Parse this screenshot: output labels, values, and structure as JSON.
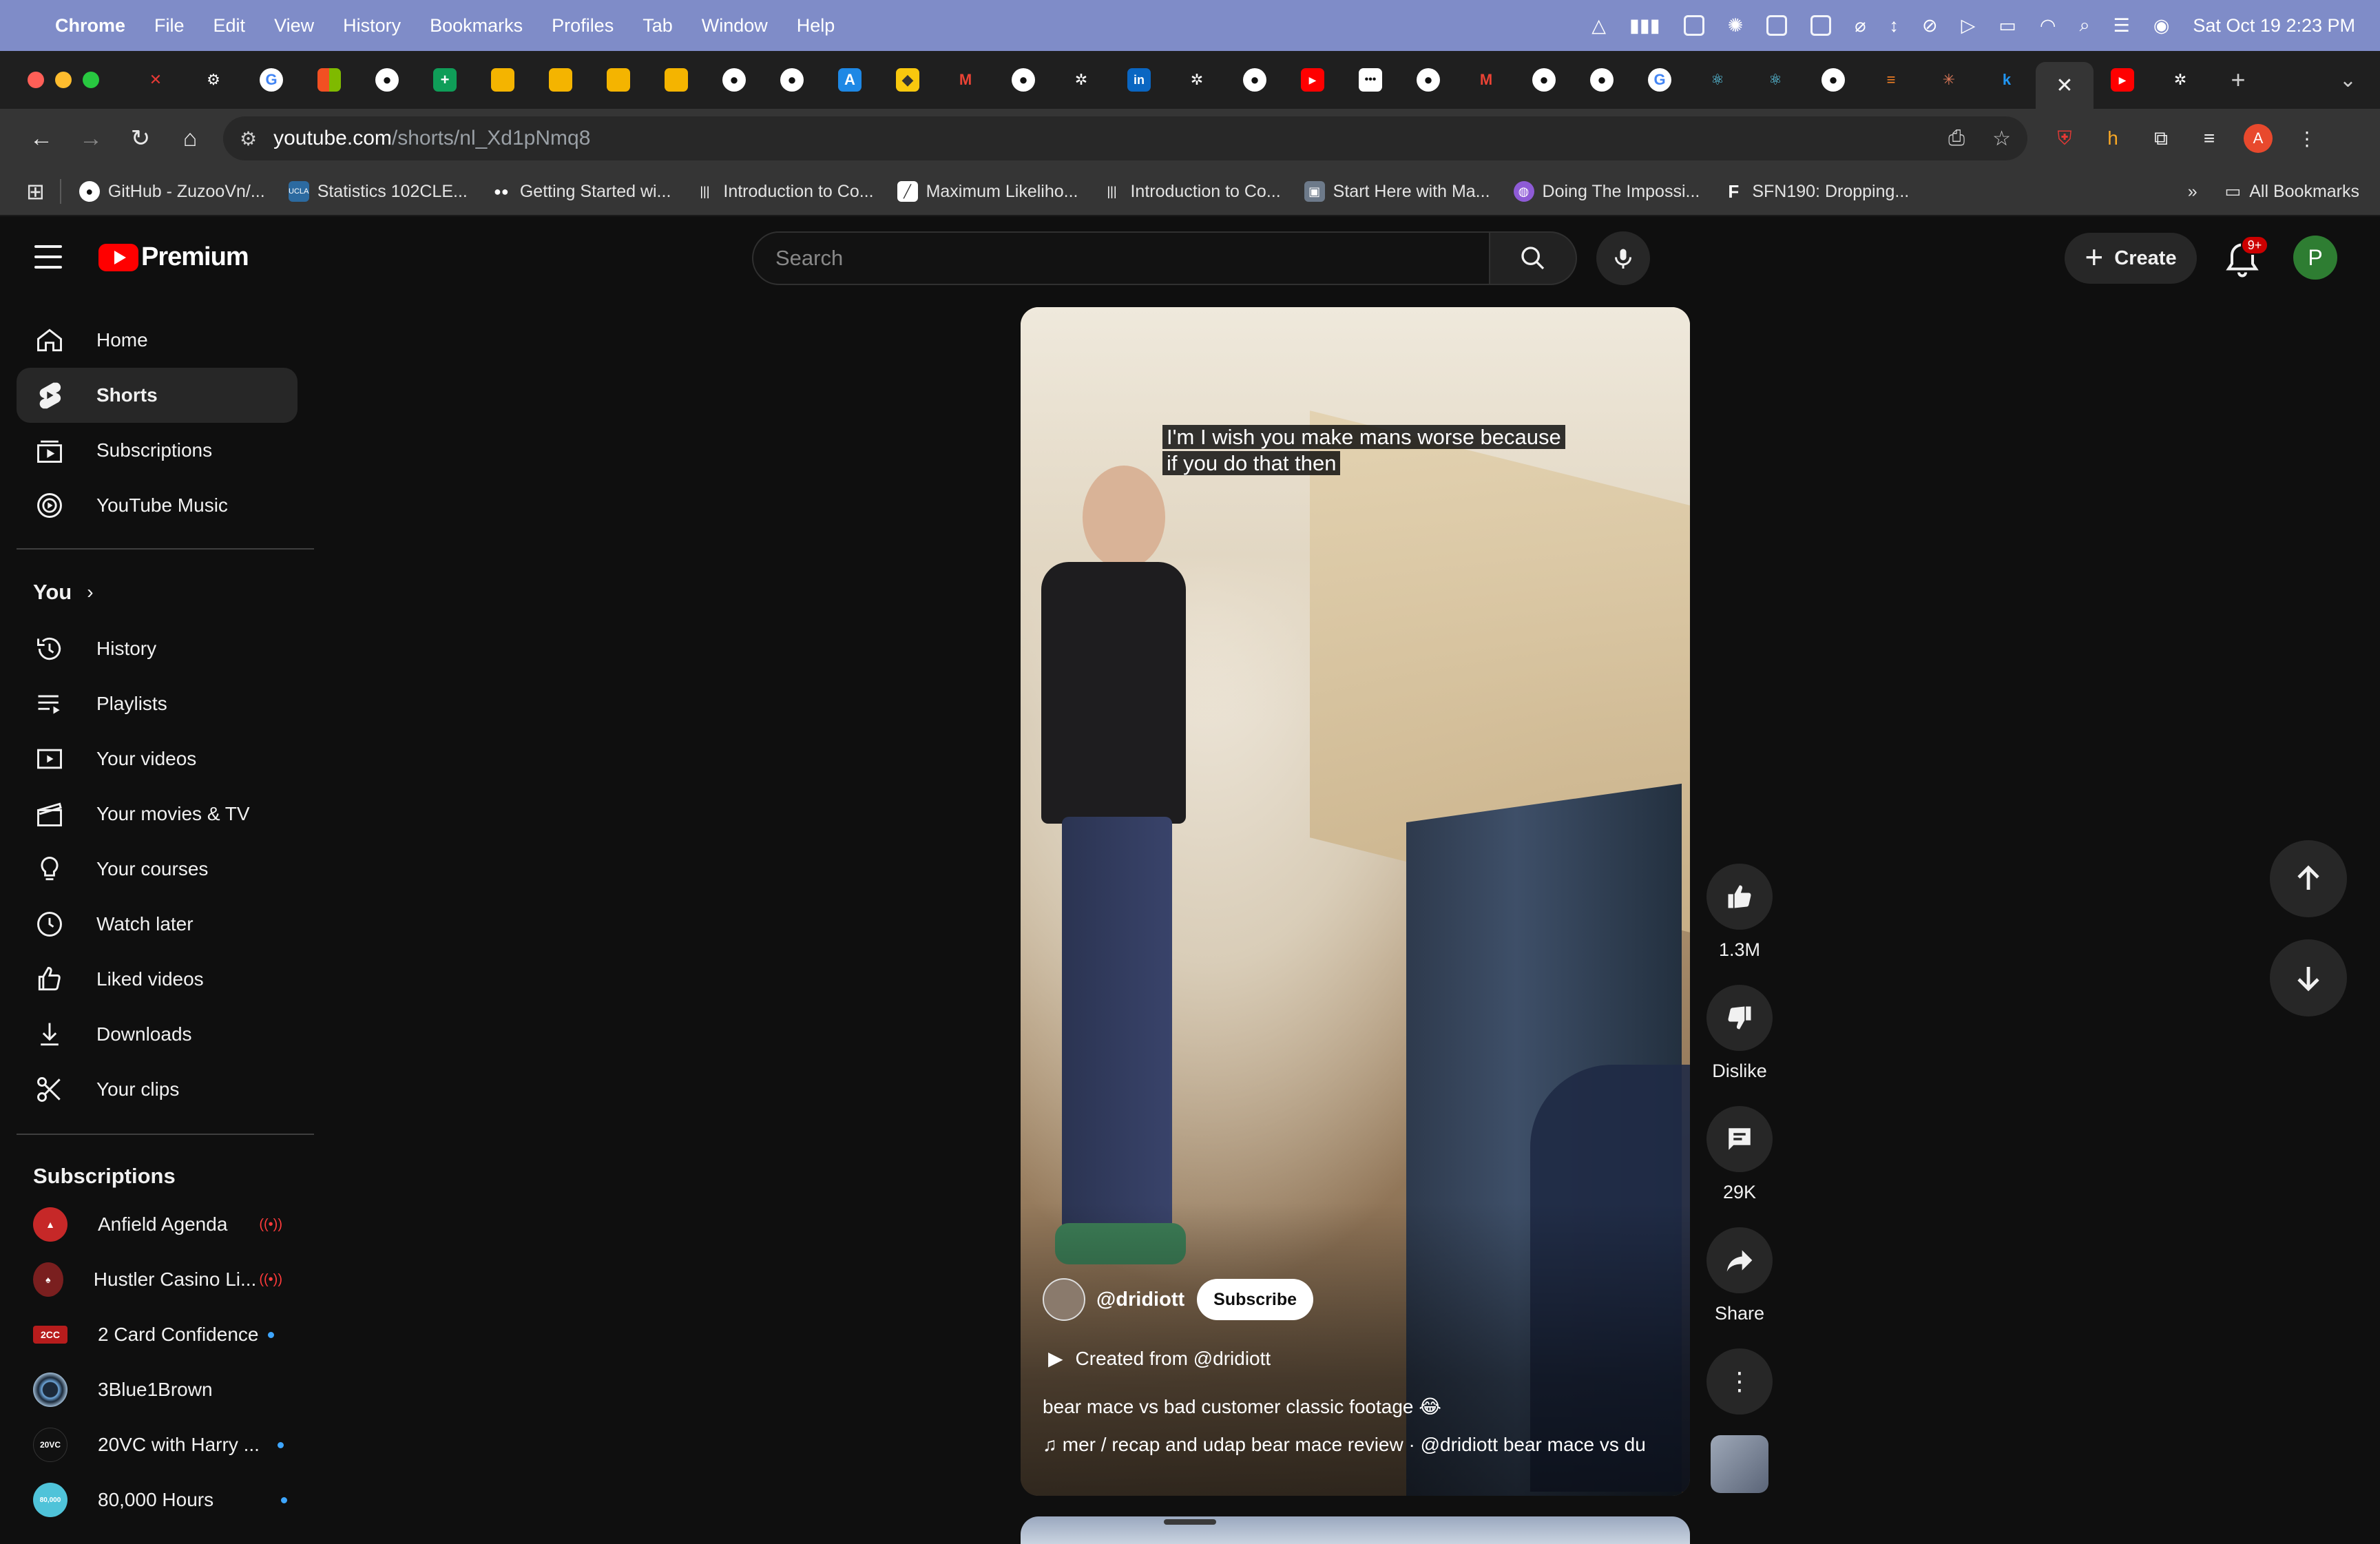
{
  "menubar": {
    "app_name": "Chrome",
    "items": [
      "File",
      "Edit",
      "View",
      "History",
      "Bookmarks",
      "Profiles",
      "Tab",
      "Window",
      "Help"
    ],
    "clock": "Sat Oct 19  2:23 PM"
  },
  "browser": {
    "url_host": "youtube.com",
    "url_path": "/shorts/nl_Xd1pNmq8",
    "bookmarks": [
      {
        "label": "GitHub - ZuzooVn/...",
        "icon": "github-icon"
      },
      {
        "label": "Statistics 102CLE...",
        "icon": "ucla-icon"
      },
      {
        "label": "Getting Started wi...",
        "icon": "medium-icon"
      },
      {
        "label": "Introduction to Co...",
        "icon": "course-icon"
      },
      {
        "label": "Maximum Likeliho...",
        "icon": "doc-icon"
      },
      {
        "label": "Introduction to Co...",
        "icon": "course-icon"
      },
      {
        "label": "Start Here with Ma...",
        "icon": "image-icon"
      },
      {
        "label": "Doing The Impossi...",
        "icon": "globe-icon"
      },
      {
        "label": "SFN190: Dropping...",
        "icon": "f-icon"
      }
    ],
    "all_bookmarks": "All Bookmarks",
    "profile_initial": "A"
  },
  "masthead": {
    "logo_text": "Premium",
    "search_placeholder": "Search",
    "create_label": "Create",
    "notification_count": "9+",
    "avatar_initial": "P"
  },
  "sidebar": {
    "main": [
      {
        "label": "Home",
        "icon": "home-icon"
      },
      {
        "label": "Shorts",
        "icon": "shorts-icon",
        "active": true
      },
      {
        "label": "Subscriptions",
        "icon": "subscriptions-icon"
      },
      {
        "label": "YouTube Music",
        "icon": "youtube-music-icon"
      }
    ],
    "you_title": "You",
    "you": [
      {
        "label": "History",
        "icon": "history-icon"
      },
      {
        "label": "Playlists",
        "icon": "playlists-icon"
      },
      {
        "label": "Your videos",
        "icon": "your-videos-icon"
      },
      {
        "label": "Your movies & TV",
        "icon": "movies-icon"
      },
      {
        "label": "Your courses",
        "icon": "courses-icon"
      },
      {
        "label": "Watch later",
        "icon": "watch-later-icon"
      },
      {
        "label": "Liked videos",
        "icon": "liked-icon"
      },
      {
        "label": "Downloads",
        "icon": "downloads-icon"
      },
      {
        "label": "Your clips",
        "icon": "clips-icon"
      }
    ],
    "subscriptions_title": "Subscriptions",
    "subscriptions": [
      {
        "name": "Anfield Agenda",
        "status": "live",
        "color": "#c62828"
      },
      {
        "name": "Hustler Casino Li...",
        "status": "live",
        "color": "#7a1f1f"
      },
      {
        "name": "2 Card Confidence",
        "status": "new",
        "color": "#b71c1c",
        "badge": "2CC"
      },
      {
        "name": "3Blue1Brown",
        "status": "none",
        "color": "#1c2a3a"
      },
      {
        "name": "20VC with Harry ...",
        "status": "new",
        "color": "#111111",
        "badge": "20VC"
      },
      {
        "name": "80,000 Hours",
        "status": "new",
        "color": "#4fc3d9",
        "badge": "80,000"
      }
    ]
  },
  "short": {
    "caption_line1": "I'm I wish you make mans worse because",
    "caption_line2": "if you do that then",
    "channel": "@dridiott",
    "subscribe_label": "Subscribe",
    "created_from": "Created from @dridiott",
    "description": "bear mace vs bad customer classic footage 😂",
    "music": "mer / recap and udap bear mace review · @dridiott    bear mace vs du"
  },
  "actions": {
    "likes": "1.3M",
    "dislike_label": "Dislike",
    "comments": "29K",
    "share_label": "Share"
  },
  "colors": {
    "brand_red": "#ff0000",
    "background": "#0f0f0f",
    "surface": "#272727",
    "menubar": "#7f8cc8"
  }
}
